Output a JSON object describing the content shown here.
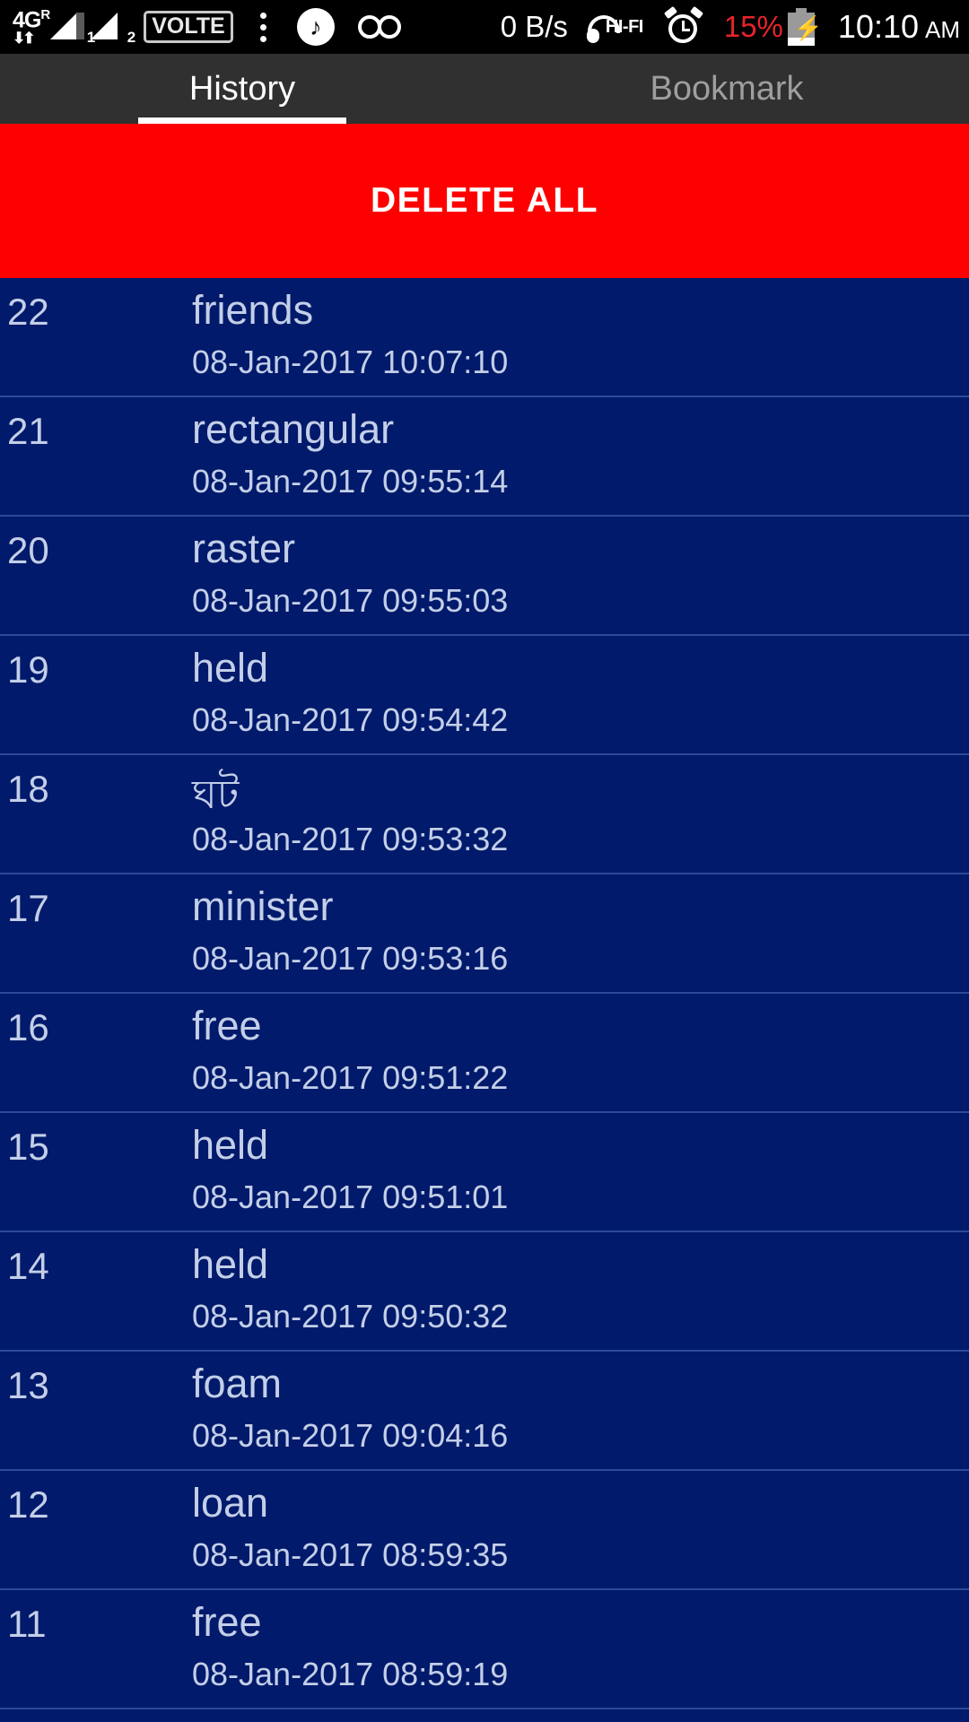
{
  "status_bar": {
    "network_type": "4G",
    "network_roam": "R",
    "data_arrows": "arrows-up-down-icon",
    "sim1_label": "1",
    "sim2_label": "2",
    "volte": "VOLTE",
    "overflow": "kebab-menu-icon",
    "music": "music-note-icon",
    "voicemail": "voicemail-icon",
    "data_speed": "0 B/s",
    "hifi": "HI-FI",
    "alarm": "alarm-clock-icon",
    "battery_percent": "15%",
    "battery_state": "charging",
    "time": "10:10",
    "ampm": "AM"
  },
  "tabs": [
    {
      "label": "History",
      "active": true
    },
    {
      "label": "Bookmark",
      "active": false
    }
  ],
  "toolbar": {
    "delete_all_label": "DELETE ALL"
  },
  "colors": {
    "status_bar_bg": "#000000",
    "tab_bar_bg": "#303030",
    "tab_active_text": "#ffffff",
    "tab_inactive_text": "#9e9e9e",
    "delete_bar_bg": "#ff0000",
    "delete_bar_text": "#ffffff",
    "list_bg": "#021a6b",
    "list_text": "#c3cfe8",
    "list_divider": "#2d4a9a",
    "battery_percent_text": "#e8242a"
  },
  "history": {
    "columns": [
      "index",
      "term",
      "timestamp"
    ],
    "items": [
      {
        "index": "22",
        "term": "friends",
        "timestamp": "08-Jan-2017 10:07:10"
      },
      {
        "index": "21",
        "term": "rectangular",
        "timestamp": "08-Jan-2017 09:55:14"
      },
      {
        "index": "20",
        "term": "raster",
        "timestamp": "08-Jan-2017 09:55:03"
      },
      {
        "index": "19",
        "term": "held",
        "timestamp": "08-Jan-2017 09:54:42"
      },
      {
        "index": "18",
        "term": "ঘট",
        "timestamp": "08-Jan-2017 09:53:32"
      },
      {
        "index": "17",
        "term": "minister",
        "timestamp": "08-Jan-2017 09:53:16"
      },
      {
        "index": "16",
        "term": "free",
        "timestamp": "08-Jan-2017 09:51:22"
      },
      {
        "index": "15",
        "term": "held",
        "timestamp": "08-Jan-2017 09:51:01"
      },
      {
        "index": "14",
        "term": "held",
        "timestamp": "08-Jan-2017 09:50:32"
      },
      {
        "index": "13",
        "term": "foam",
        "timestamp": "08-Jan-2017 09:04:16"
      },
      {
        "index": "12",
        "term": "loan",
        "timestamp": "08-Jan-2017 08:59:35"
      },
      {
        "index": "11",
        "term": "free",
        "timestamp": "08-Jan-2017 08:59:19"
      }
    ]
  }
}
